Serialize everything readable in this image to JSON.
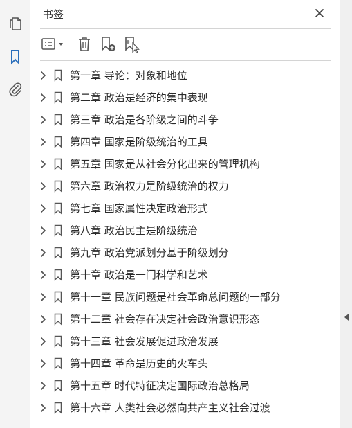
{
  "panel": {
    "title": "书签"
  },
  "rail": {
    "items": [
      {
        "name": "pages-icon",
        "active": false
      },
      {
        "name": "bookmark-icon",
        "active": true
      },
      {
        "name": "attachment-icon",
        "active": false
      }
    ]
  },
  "toolbar": {
    "buttons": [
      "options-menu-icon",
      "trash-icon",
      "new-bookmark-icon",
      "bookmark-from-selection-icon"
    ]
  },
  "bookmarks": [
    {
      "label": "第一章  导论：对象和地位"
    },
    {
      "label": "第二章  政治是经济的集中表现"
    },
    {
      "label": "第三章  政治是各阶级之间的斗争"
    },
    {
      "label": "第四章  国家是阶级统治的工具"
    },
    {
      "label": "第五章  国家是从社会分化出来的管理机构"
    },
    {
      "label": "第六章  政治权力是阶级统治的权力"
    },
    {
      "label": "第七章  国家属性决定政治形式"
    },
    {
      "label": "第八章  政治民主是阶级统治"
    },
    {
      "label": "第九章  政治党派划分基于阶级划分"
    },
    {
      "label": "第十章  政治是一门科学和艺术"
    },
    {
      "label": "第十一章  民族问题是社会革命总问题的一部分"
    },
    {
      "label": "第十二章  社会存在决定社会政治意识形态"
    },
    {
      "label": "第十三章  社会发展促进政治发展"
    },
    {
      "label": "第十四章  革命是历史的火车头"
    },
    {
      "label": "第十五章  时代特征决定国际政治总格局"
    },
    {
      "label": "第十六章  人类社会必然向共产主义社会过渡"
    }
  ],
  "colors": {
    "accent": "#2a6ebb",
    "icon": "#555555",
    "text": "#2b2b2b"
  }
}
